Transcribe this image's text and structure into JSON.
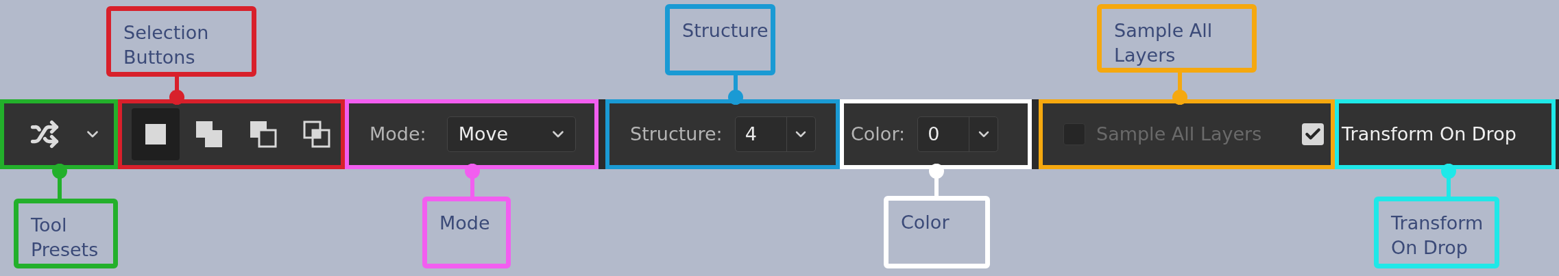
{
  "sections": [
    {
      "kind": "presets",
      "callout": {
        "label": "Tool Presets",
        "color": "#23b02b"
      }
    },
    {
      "kind": "selection",
      "callout": {
        "label": "Selection Buttons",
        "color": "#d8202b"
      },
      "buttons": [
        {
          "kind": "new",
          "selected": true
        },
        {
          "kind": "add",
          "selected": false
        },
        {
          "kind": "subtract",
          "selected": false
        },
        {
          "kind": "intersect",
          "selected": false
        }
      ]
    },
    {
      "kind": "dropdown",
      "label": "Mode:",
      "value": "Move",
      "callout": {
        "label": "Mode",
        "color": "#f25ef0"
      }
    },
    {
      "kind": "spinner",
      "label": "Structure:",
      "value": "4",
      "callout": {
        "label": "Structure",
        "color": "#1a9ad4"
      }
    },
    {
      "kind": "spinner",
      "label": "Color:",
      "value": "0",
      "callout": {
        "label": "Color",
        "color": "#ffffff"
      }
    },
    {
      "kind": "checkbox",
      "label": "Sample All Layers",
      "checked": false,
      "disabled": true,
      "callout": {
        "label": "Sample All Layers",
        "color": "#f5a80f"
      }
    },
    {
      "kind": "toggle",
      "label": "Transform On Drop",
      "checked": true,
      "callout": {
        "label": "Transform On Drop",
        "color": "#1fe8e8"
      }
    }
  ]
}
